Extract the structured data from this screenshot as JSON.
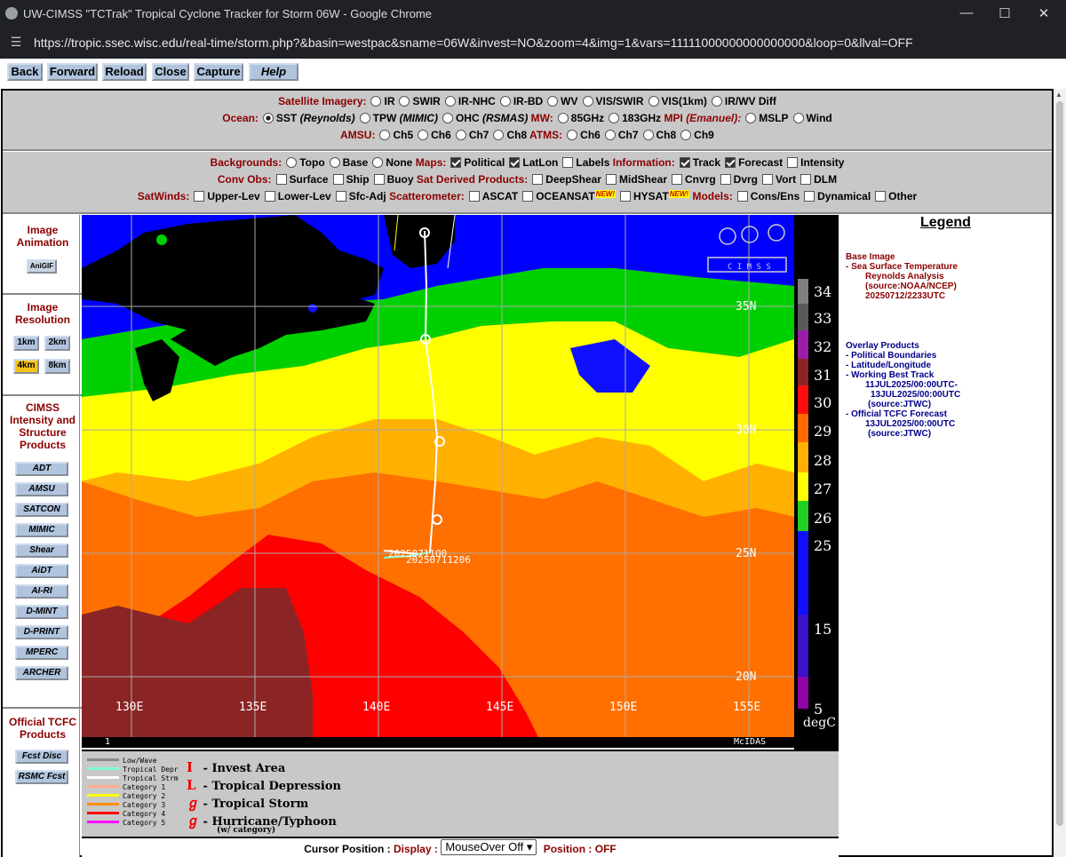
{
  "browser": {
    "title": "UW-CIMSS \"TCTrak\" Tropical Cyclone Tracker for Storm 06W - Google Chrome",
    "url": "https://tropic.ssec.wisc.edu/real-time/storm.php?&basin=westpac&sname=06W&invest=NO&zoom=4&img=1&vars=11111000000000000000&loop=0&llval=OFF"
  },
  "toolbar": {
    "back": "Back",
    "forward": "Forward",
    "reload": "Reload",
    "close": "Close",
    "capture": "Capture",
    "help": "Help"
  },
  "top_panel": {
    "sat_label": "Satellite Imagery:",
    "sat_options": [
      "IR",
      "SWIR",
      "IR-NHC",
      "IR-BD",
      "WV",
      "VIS/SWIR",
      "VIS(1km)",
      "IR/WV Diff"
    ],
    "ocean_label": "Ocean:",
    "ocean_sst": "SST",
    "ocean_sst_src": "(Reynolds)",
    "ocean_tpw": "TPW",
    "ocean_tpw_src": "(MIMIC)",
    "ocean_ohc": "OHC",
    "ocean_ohc_src": "(RSMAS)",
    "mw_label": "MW:",
    "mw_options": [
      "85GHz",
      "183GHz"
    ],
    "mpi_label": "MPI",
    "mpi_src": "(Emanuel):",
    "mpi_options": [
      "MSLP",
      "Wind"
    ],
    "amsu_label": "AMSU:",
    "amsu_options": [
      "Ch5",
      "Ch6",
      "Ch7",
      "Ch8"
    ],
    "atms_label": "ATMS:",
    "atms_options": [
      "Ch6",
      "Ch7",
      "Ch8",
      "Ch9"
    ]
  },
  "overlay_panel": {
    "backgrounds_label": "Backgrounds:",
    "backgrounds": [
      "Topo",
      "Base",
      "None"
    ],
    "maps_label": "Maps:",
    "maps": [
      "Political",
      "LatLon",
      "Labels"
    ],
    "info_label": "Information:",
    "info": [
      "Track",
      "Forecast",
      "Intensity"
    ],
    "convobs_label": "Conv Obs:",
    "convobs": [
      "Surface",
      "Ship",
      "Buoy"
    ],
    "satderived_label": "Sat Derived Products:",
    "satderived": [
      "DeepShear",
      "MidShear",
      "Cnvrg",
      "Dvrg",
      "Vort",
      "DLM"
    ],
    "satwinds_label": "SatWinds:",
    "satwinds": [
      "Upper-Lev",
      "Lower-Lev",
      "Sfc-Adj"
    ],
    "scat_label": "Scatterometer:",
    "scat": [
      "ASCAT",
      "OCEANSAT",
      "HYSAT"
    ],
    "new_badge": "NEW!",
    "models_label": "Models:",
    "models": [
      "Cons/Ens",
      "Dynamical",
      "Other"
    ]
  },
  "left": {
    "anim_title": "Image Animation",
    "anim_btn": "AniGIF",
    "res_title": "Image Resolution",
    "res": [
      "1km",
      "2km",
      "4km",
      "8km"
    ],
    "cimss_title": "CIMSS Intensity and Structure Products",
    "products": [
      "ADT",
      "AMSU",
      "SATCON",
      "MIMIC",
      "Shear",
      "AiDT",
      "AI-RI",
      "D-MINT",
      "D-PRINT",
      "MPERC",
      "ARCHER"
    ],
    "tcfc_title": "Official TCFC Products",
    "tcfc": [
      "Fcst Disc",
      "RSMC Fcst"
    ]
  },
  "map": {
    "lat_labels": [
      "35N",
      "30N",
      "25N",
      "20N"
    ],
    "lon_labels": [
      "130E",
      "135E",
      "140E",
      "145E",
      "150E",
      "155E"
    ],
    "date1": "20250711Q0",
    "date2": "20250711206",
    "footer_left": "1",
    "footer_right": "McIDAS"
  },
  "colorbar": {
    "ticks": [
      "34",
      "33",
      "32",
      "31",
      "30",
      "29",
      "28",
      "27",
      "26",
      "25",
      "15",
      "5"
    ],
    "unit": "degC",
    "colors": [
      "#7f7f7f",
      "#5a5a5a",
      "#9b1fa6",
      "#8b2525",
      "#ff0d0d",
      "#ff6a00",
      "#ffb000",
      "#ffff00",
      "#22d022",
      "#1010ff",
      "#3a12c8",
      "#8d05a6"
    ]
  },
  "legend": {
    "title": "Legend",
    "base_h": "Base Image",
    "base_lines": [
      "- Sea Surface Temperature",
      "Reynolds Analysis",
      "(source:NOAA/NCEP)",
      "20250712/2233UTC"
    ],
    "overlay_h": "Overlay Products",
    "overlay_lines": [
      "- Political Boundaries",
      "- Latitude/Longitude",
      "- Working Best Track",
      "11JUL2025/00:00UTC-",
      "13JUL2025/00:00UTC",
      "(source:JTWC)",
      "- Official TCFC Forecast",
      "13JUL2025/00:00UTC",
      "(source:JTWC)"
    ]
  },
  "track_legend": {
    "classes": [
      "Low/Wave",
      "Tropical Depr",
      "Tropical Strm",
      "Category 1",
      "Category 2",
      "Category 3",
      "Category 4",
      "Category 5"
    ],
    "class_colors": [
      "#888888",
      "#7fffd4",
      "#ffffff",
      "#ffb090",
      "#ffff00",
      "#ff8c00",
      "#ff0000",
      "#ff00ff"
    ],
    "symbols": [
      "- Invest Area",
      "- Tropical Depression",
      "- Tropical Storm",
      "- Hurricane/Typhoon"
    ],
    "note": "(w/ category)"
  },
  "cursor": {
    "label": "Cursor Position :",
    "display_label": "Display :",
    "select_value": "MouseOver Off",
    "position_label": "Position :",
    "position_value": "OFF"
  }
}
